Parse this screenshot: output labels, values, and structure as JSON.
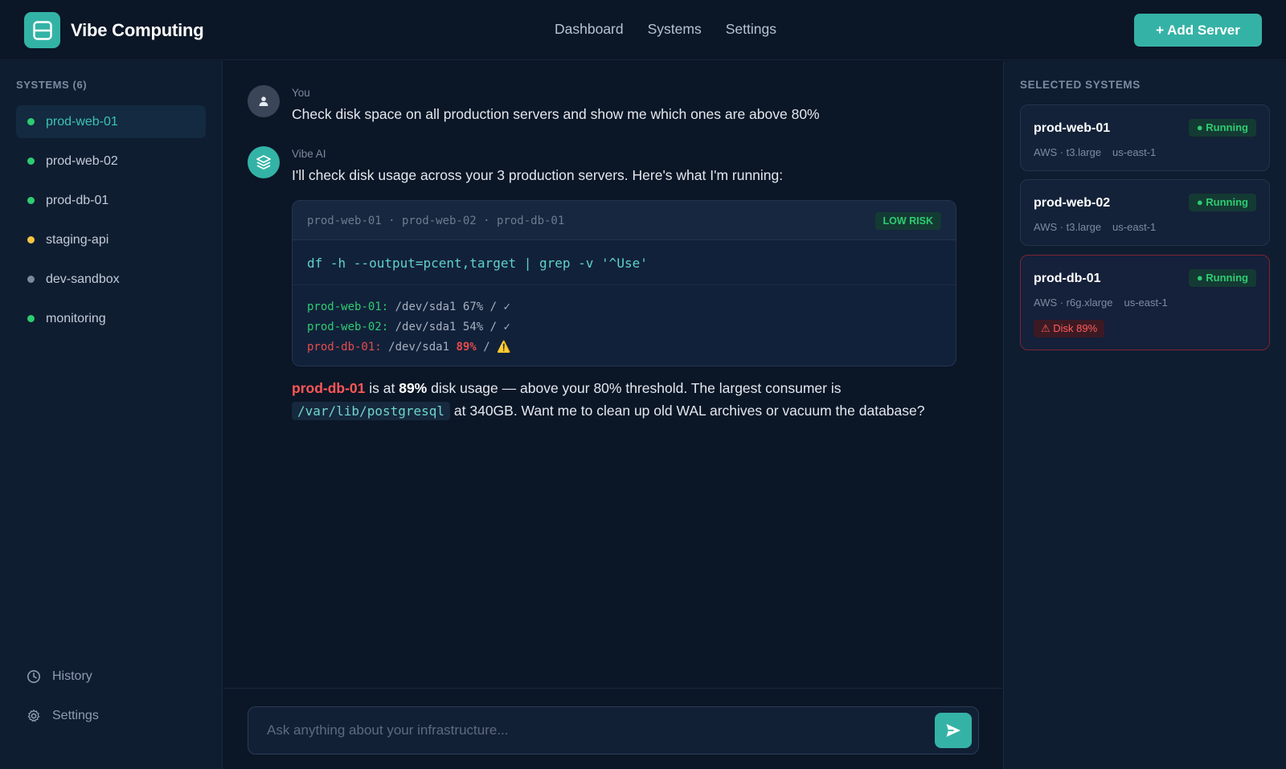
{
  "app": {
    "name": "Vibe Computing",
    "nav": [
      "Dashboard",
      "Systems",
      "Settings"
    ],
    "add_button": "+ Add Server"
  },
  "sidebar": {
    "heading": "SYSTEMS (6)",
    "items": [
      {
        "label": "prod-web-01",
        "status_color": "#2ecc71",
        "active": true
      },
      {
        "label": "prod-web-02",
        "status_color": "#2ecc71",
        "active": false
      },
      {
        "label": "prod-db-01",
        "status_color": "#2ecc71",
        "active": false
      },
      {
        "label": "staging-api",
        "status_color": "#f5c542",
        "active": false
      },
      {
        "label": "dev-sandbox",
        "status_color": "#7d8898",
        "active": false
      },
      {
        "label": "monitoring",
        "status_color": "#2ecc71",
        "active": false
      }
    ],
    "bottom": [
      {
        "label": "History",
        "icon": "clock-icon"
      },
      {
        "label": "Settings",
        "icon": "gear-icon"
      }
    ]
  },
  "chat": {
    "user_message": {
      "author": "You",
      "text": "Check disk space on all production servers and show me which ones are above 80%"
    },
    "ai_message": {
      "author": "Vibe AI",
      "text": "I'll check disk usage across your 3 production servers. Here's what I'm running:"
    },
    "command_card": {
      "targets": "prod-web-01 · prod-web-02 · prod-db-01",
      "risk": "LOW RISK",
      "command": "df -h --output=pcent,target | grep -v '^Use'",
      "output": [
        {
          "host": "prod-web-01:",
          "path": "/dev/sda1",
          "pct": "67%",
          "mount": "/",
          "mark": "✓",
          "alert": false
        },
        {
          "host": "prod-web-02:",
          "path": "/dev/sda1",
          "pct": "54%",
          "mount": "/",
          "mark": "✓",
          "alert": false
        },
        {
          "host": "prod-db-01:",
          "path": "/dev/sda1",
          "pct": "89%",
          "mount": "/",
          "mark": "⚠️",
          "alert": true
        }
      ]
    },
    "summary": {
      "host": "prod-db-01",
      "part1": " is at ",
      "pct": "89%",
      "part2": " disk usage — above your 80% threshold. The largest consumer is",
      "path": "/var/lib/postgresql",
      "part3": " at 340GB. Want me to clean up old WAL archives or vacuum the database?"
    },
    "composer_placeholder": "Ask anything about your infrastructure..."
  },
  "selected": {
    "heading": "SELECTED SYSTEMS",
    "cards": [
      {
        "name": "prod-web-01",
        "status": "● Running",
        "provider": "AWS · t3.large",
        "region": "us-east-1",
        "alert": ""
      },
      {
        "name": "prod-web-02",
        "status": "● Running",
        "provider": "AWS · t3.large",
        "region": "us-east-1",
        "alert": ""
      },
      {
        "name": "prod-db-01",
        "status": "● Running",
        "provider": "AWS · r6g.xlarge",
        "region": "us-east-1",
        "alert": "⚠ Disk 89%"
      }
    ]
  },
  "colors": {
    "accent": "#35b2a6",
    "success": "#2ecc71",
    "danger": "#ff5757",
    "warning": "#f5c542"
  }
}
